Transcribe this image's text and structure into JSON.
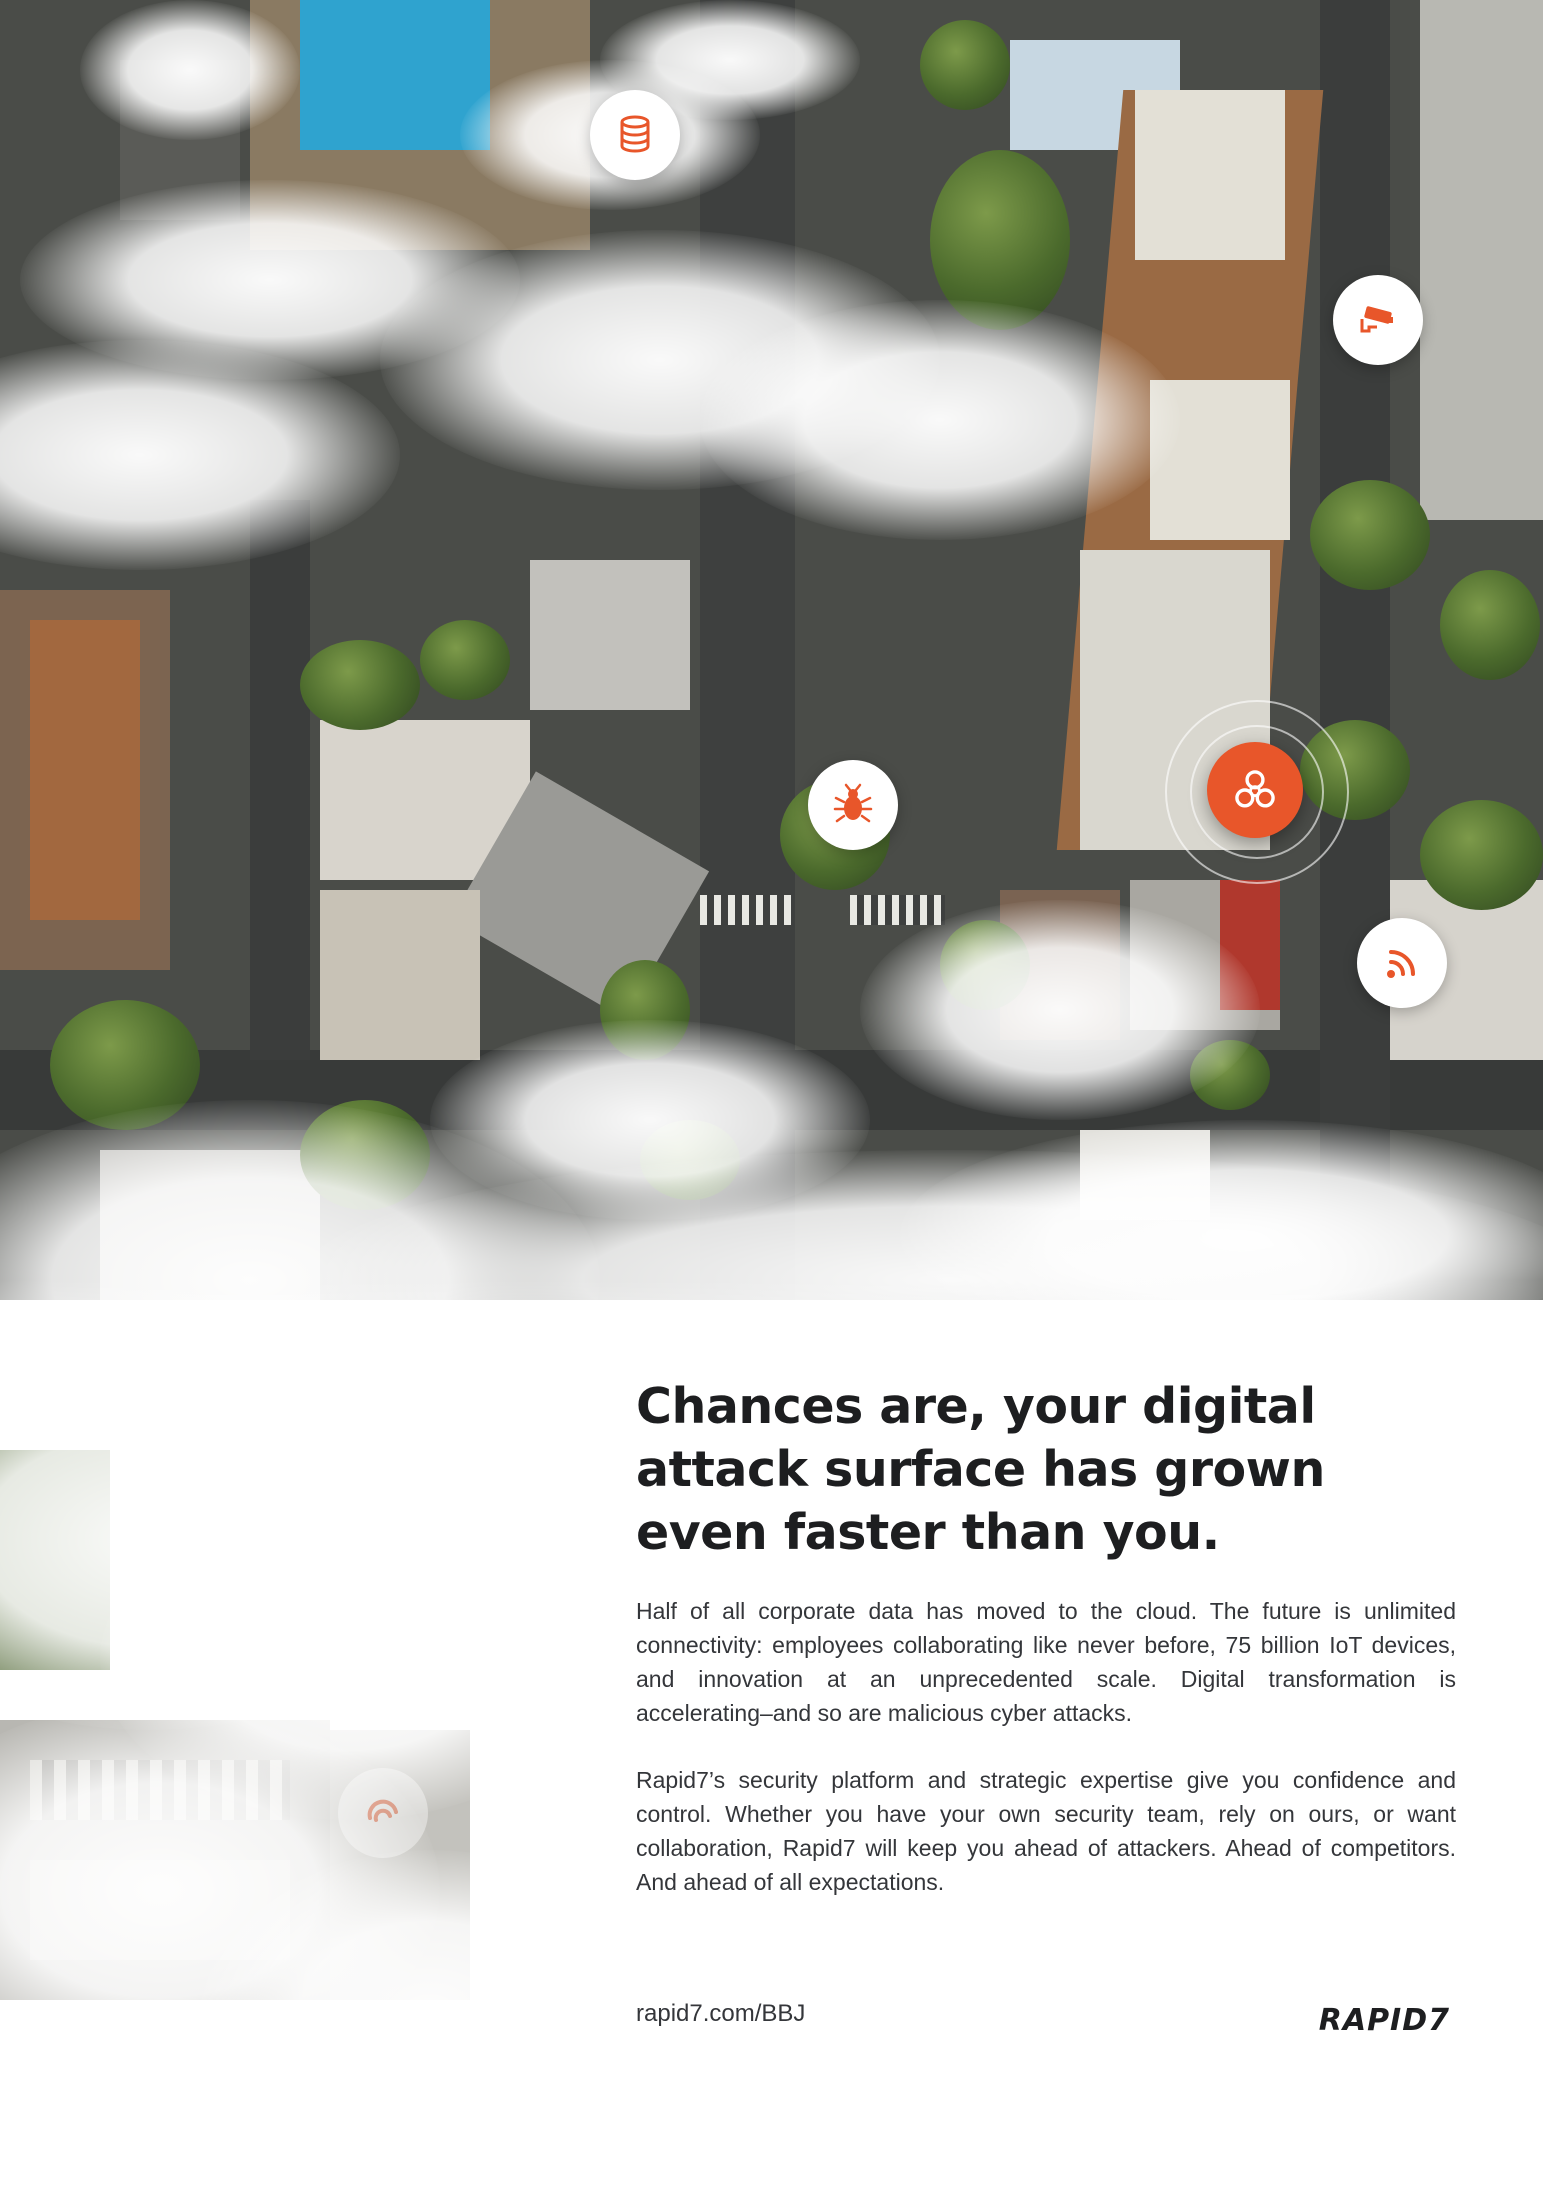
{
  "brand": {
    "name": "Rapid7",
    "accent_color": "#e8562a",
    "text_color": "#1d1e20"
  },
  "hero": {
    "icons": [
      "database-icon",
      "security-camera-icon",
      "bug-icon",
      "biohazard-icon",
      "wifi-signal-icon",
      "cloud-sync-icon"
    ]
  },
  "ad": {
    "headline": "Chances are, your digital attack surface has grown even faster than you.",
    "paragraphs": [
      "Half of all corporate data has moved to the cloud. The future is unlimited connectivity: employees collaborating like never before, 75 billion IoT devices, and innovation at an unprecedented scale. Digital transformation is accelerating–and so are malicious cyber attacks.",
      "Rapid7’s security platform and strategic expertise give you confidence and control. Whether you have your own security team, rely on ours, or want collaboration, Rapid7 will keep you ahead of attackers. Ahead of competitors. And ahead of all expectations."
    ],
    "url": "rapid7.com/BBJ",
    "logo_text": "RAPID7"
  }
}
